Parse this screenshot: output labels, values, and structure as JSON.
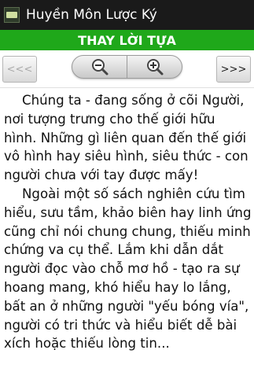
{
  "app": {
    "title": "Huyền Môn Lược Ký",
    "icon": "book-icon"
  },
  "header": {
    "title": "THAY LỜI TỰA",
    "color": "#1fa81a"
  },
  "toolbar": {
    "prev_label": "<<<",
    "next_label": ">>>",
    "zoom_out_icon": "zoom-out-icon",
    "zoom_in_icon": "zoom-in-icon"
  },
  "content": {
    "paragraphs": [
      "Chúng ta - đang sống ở cõi Người, nơi tượng trưng cho thế giới hữu hình. Những gì liên quan đến thế giới vô hình hay siêu hình, siêu thức - con người chưa với tay được mấy!",
      "Ngoài một số sách nghiên cứu tìm hiểu, sưu tầm, khảo biên hay linh ứng cũng chỉ nói chung chung, thiếu minh chứng va cụ thể. Lắm khi dẫn dắt người đọc vào chỗ mơ hồ - tạo ra sự hoang mang, khó hiểu hay lo lắng, bất an ở những người \"yếu bóng vía\", người có tri thức và hiểu biết dễ bài xích hoặc thiếu lòng tin..."
    ]
  }
}
